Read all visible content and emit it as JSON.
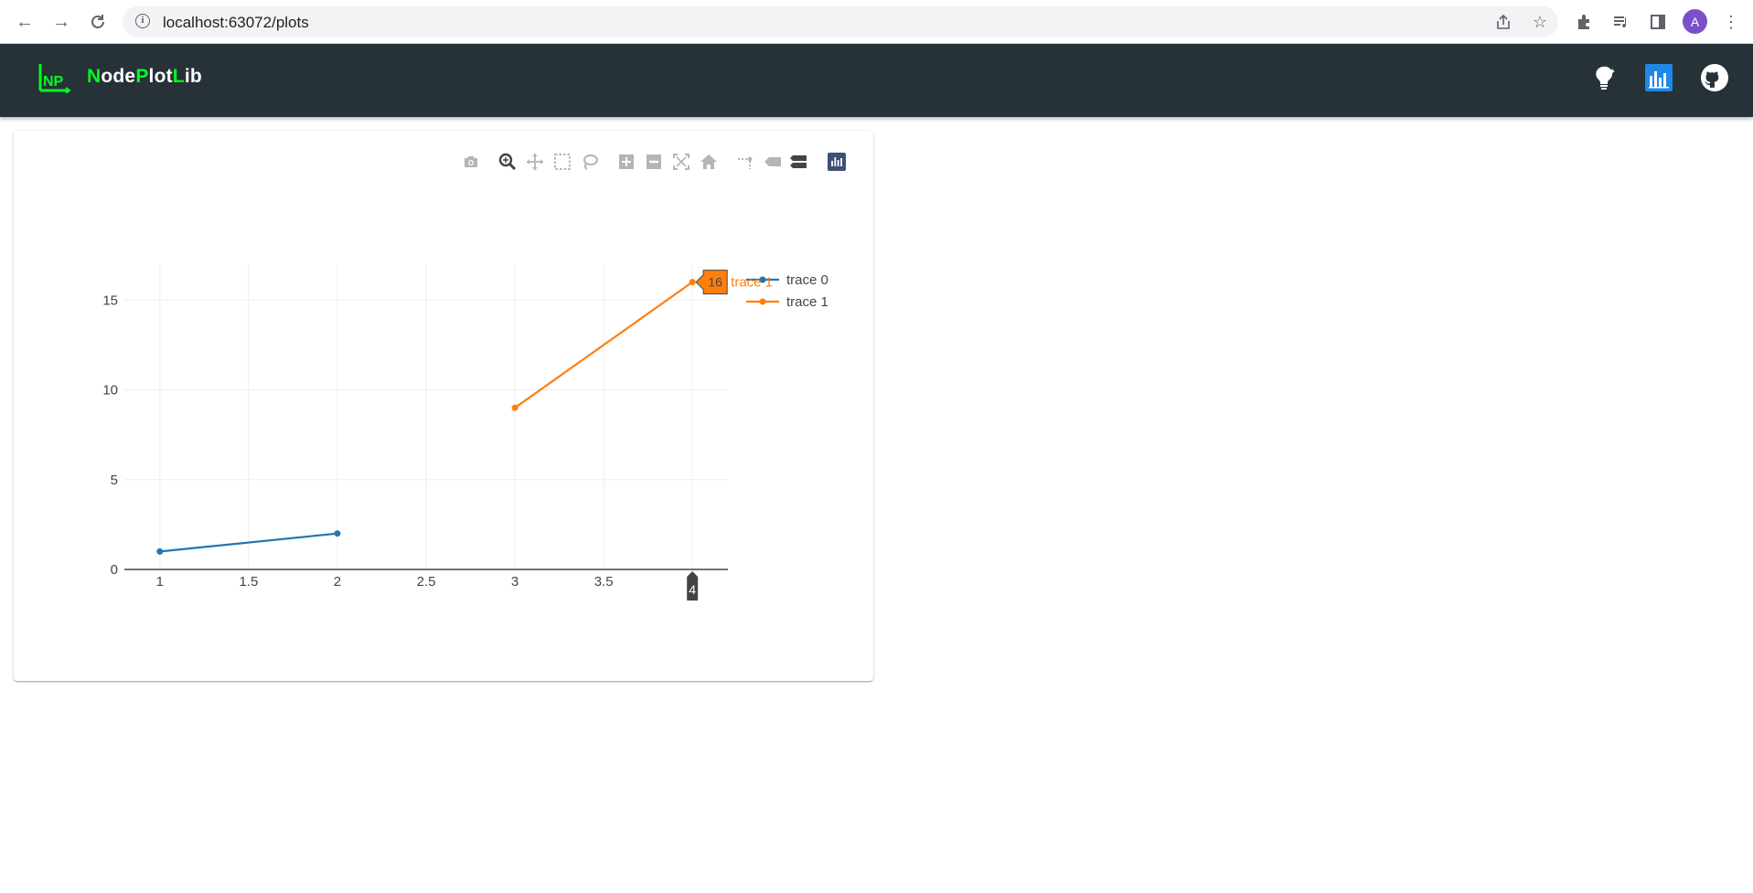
{
  "browser": {
    "url": "localhost:63072/plots",
    "avatar_letter": "A",
    "icons": [
      "back-icon",
      "forward-icon",
      "reload-icon",
      "site-info-icon",
      "share-icon",
      "bookmark-star-icon",
      "extensions-icon",
      "reading-list-icon",
      "side-panel-icon",
      "menu-kebab-icon"
    ]
  },
  "app": {
    "brand": {
      "n": "N",
      "ode": "ode",
      "p": "P",
      "lot": "lot",
      "l": "L",
      "ib": "ib"
    },
    "logo_text": "NP",
    "colors": {
      "header_bg": "#263238",
      "brand_green": "#00ff1f",
      "chart_icon_bg": "#1e88e5"
    },
    "header_icons": [
      "lightbulb-icon",
      "plot-chart-icon",
      "github-icon"
    ]
  },
  "modebar": {
    "buttons": [
      "camera-icon",
      "zoom-icon",
      "pan-icon",
      "box-select-icon",
      "lasso-select-icon",
      "zoom-in-icon",
      "zoom-out-icon",
      "autoscale-icon",
      "reset-axes-icon",
      "spike-lines-icon",
      "hover-closest-icon",
      "hover-compare-icon",
      "plotly-logo-icon"
    ]
  },
  "chart_data": {
    "type": "line",
    "title": "",
    "xlabel": "",
    "ylabel": "",
    "xlim": [
      0.8,
      4.2
    ],
    "ylim": [
      0,
      17
    ],
    "grid": true,
    "legend_position": "top-right",
    "x_ticks": [
      "1",
      "1.5",
      "2",
      "2.5",
      "3",
      "3.5",
      "4"
    ],
    "y_ticks": [
      "0",
      "5",
      "10",
      "15"
    ],
    "series": [
      {
        "name": "trace 0",
        "x": [
          1,
          2
        ],
        "y": [
          1,
          2
        ],
        "color": "#1f77b4"
      },
      {
        "name": "trace 1",
        "x": [
          3,
          4
        ],
        "y": [
          9,
          16
        ],
        "color": "#ff7f0e"
      }
    ],
    "hover": {
      "x_label": "4",
      "y_label": "16",
      "series_label": "trace 1"
    }
  }
}
